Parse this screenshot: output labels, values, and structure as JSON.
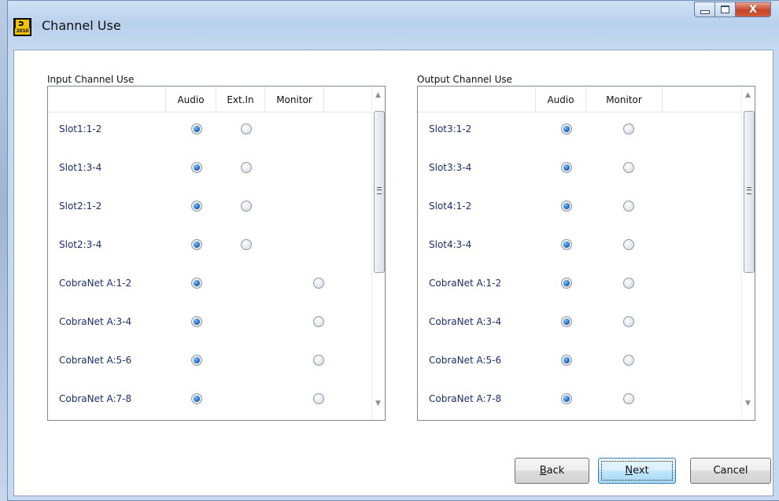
{
  "window": {
    "title": "Channel Use",
    "logo_text": "2010",
    "close_glyph": "X"
  },
  "input_group": {
    "label": "Input Channel Use",
    "columns": [
      "Audio",
      "Ext.In",
      "Monitor"
    ],
    "rows": [
      {
        "label": "Slot1:1-2",
        "audio": true,
        "extin": false,
        "monitor": null
      },
      {
        "label": "Slot1:3-4",
        "audio": true,
        "extin": false,
        "monitor": null
      },
      {
        "label": "Slot2:1-2",
        "audio": true,
        "extin": false,
        "monitor": null
      },
      {
        "label": "Slot2:3-4",
        "audio": true,
        "extin": false,
        "monitor": null
      },
      {
        "label": "CobraNet A:1-2",
        "audio": true,
        "extin": null,
        "monitor": false
      },
      {
        "label": "CobraNet A:3-4",
        "audio": true,
        "extin": null,
        "monitor": false
      },
      {
        "label": "CobraNet A:5-6",
        "audio": true,
        "extin": null,
        "monitor": false
      },
      {
        "label": "CobraNet A:7-8",
        "audio": true,
        "extin": null,
        "monitor": false
      }
    ]
  },
  "output_group": {
    "label": "Output Channel Use",
    "columns": [
      "Audio",
      "Monitor"
    ],
    "rows": [
      {
        "label": "Slot3:1-2",
        "audio": true,
        "monitor": false
      },
      {
        "label": "Slot3:3-4",
        "audio": true,
        "monitor": false
      },
      {
        "label": "Slot4:1-2",
        "audio": true,
        "monitor": false
      },
      {
        "label": "Slot4:3-4",
        "audio": true,
        "monitor": false
      },
      {
        "label": "CobraNet A:1-2",
        "audio": true,
        "monitor": false
      },
      {
        "label": "CobraNet A:3-4",
        "audio": true,
        "monitor": false
      },
      {
        "label": "CobraNet A:5-6",
        "audio": true,
        "monitor": false
      },
      {
        "label": "CobraNet A:7-8",
        "audio": true,
        "monitor": false
      }
    ]
  },
  "buttons": {
    "back_mnemonic": "B",
    "back_rest": "ack",
    "next_mnemonic": "N",
    "next_rest": "ext",
    "cancel": "Cancel"
  }
}
